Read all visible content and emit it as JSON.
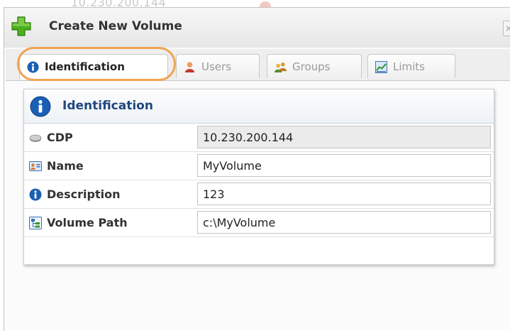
{
  "background": {
    "ghost_text": "10.230.200.144"
  },
  "dialog": {
    "title": "Create New Volume",
    "close_glyph": "×",
    "icons": {
      "title": "plus-icon",
      "close": "close-icon"
    }
  },
  "tabs": [
    {
      "label": "Identification",
      "icon": "info-icon",
      "active": true
    },
    {
      "label": "Users",
      "icon": "user-icon",
      "active": false
    },
    {
      "label": "Groups",
      "icon": "groups-icon",
      "active": false
    },
    {
      "label": "Limits",
      "icon": "chart-icon",
      "active": false
    }
  ],
  "panel": {
    "title": "Identification",
    "rows": [
      {
        "label": "CDP",
        "icon": "cdp-icon",
        "value": "10.230.200.144",
        "readonly": true
      },
      {
        "label": "Name",
        "icon": "name-icon",
        "value": "MyVolume",
        "readonly": false
      },
      {
        "label": "Description",
        "icon": "info-icon",
        "value": "123",
        "readonly": false
      },
      {
        "label": "Volume Path",
        "icon": "path-icon",
        "value": "c:\\MyVolume",
        "readonly": false
      }
    ]
  },
  "colors": {
    "highlight_oval": "#f0a452",
    "panel_title": "#20477f",
    "info_blue": "#1a5fb4",
    "plus_green": "#4caf1c"
  }
}
